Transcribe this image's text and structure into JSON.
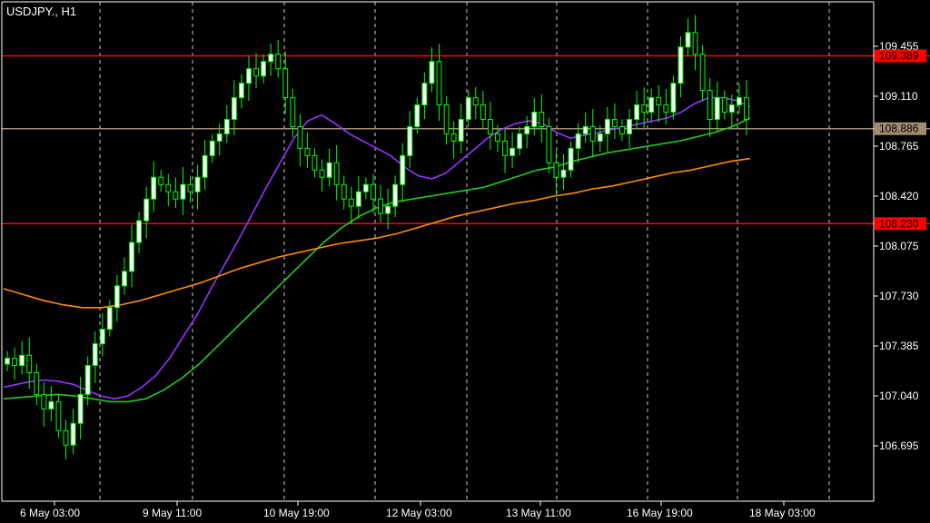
{
  "chart_data": {
    "type": "candlestick",
    "title": "USDJPY., H1",
    "x_ticks": [
      "6 May 03:00",
      "9 May 11:00",
      "10 May 19:00",
      "12 May 03:00",
      "13 May 11:00",
      "16 May 19:00",
      "18 May 03:00"
    ],
    "y_ticks": [
      109.455,
      109.11,
      108.765,
      108.42,
      108.075,
      107.73,
      107.385,
      107.04,
      106.695
    ],
    "ylim": [
      106.5,
      109.6
    ],
    "grid": true,
    "levels": [
      {
        "label": "109.389",
        "value": 109.389,
        "color": "#ff0000"
      },
      {
        "label": "108.886",
        "value": 108.886,
        "color": "#a08c6e"
      },
      {
        "label": "108.230",
        "value": 108.23,
        "color": "#ff0000"
      }
    ],
    "candles_close": [
      107.3,
      107.25,
      107.32,
      107.2,
      107.05,
      106.95,
      107.0,
      106.8,
      106.7,
      106.85,
      107.05,
      107.25,
      107.4,
      107.5,
      107.65,
      107.8,
      107.9,
      108.1,
      108.25,
      108.4,
      108.55,
      108.5,
      108.45,
      108.4,
      108.5,
      108.45,
      108.55,
      108.7,
      108.8,
      108.85,
      108.95,
      109.1,
      109.2,
      109.3,
      109.25,
      109.35,
      109.4,
      109.3,
      109.1,
      108.9,
      108.75,
      108.7,
      108.6,
      108.55,
      108.65,
      108.5,
      108.4,
      108.35,
      108.45,
      108.5,
      108.4,
      108.3,
      108.35,
      108.5,
      108.7,
      108.9,
      109.05,
      109.2,
      109.35,
      109.05,
      108.85,
      108.8,
      108.95,
      109.1,
      109.05,
      108.95,
      108.85,
      108.8,
      108.7,
      108.75,
      108.85,
      108.9,
      109.0,
      108.9,
      108.65,
      108.55,
      108.6,
      108.75,
      108.85,
      108.9,
      108.8,
      108.85,
      108.95,
      108.9,
      108.85,
      108.95,
      109.05,
      109.0,
      109.1,
      109.05,
      109.0,
      109.2,
      109.45,
      109.55,
      109.4,
      109.15,
      108.95,
      109.1,
      109.0,
      109.05,
      109.1,
      108.95
    ],
    "series": [
      {
        "name": "",
        "color": "#9933ff",
        "values": [
          107.1,
          107.12,
          107.14,
          107.15,
          107.14,
          107.12,
          107.08,
          107.04,
          107.02,
          107.04,
          107.1,
          107.18,
          107.3,
          107.45,
          107.6,
          107.78,
          107.95,
          108.12,
          108.3,
          108.48,
          108.65,
          108.82,
          108.94,
          108.98,
          108.92,
          108.85,
          108.8,
          108.75,
          108.7,
          108.62,
          108.56,
          108.54,
          108.58,
          108.66,
          108.74,
          108.82,
          108.88,
          108.92,
          108.94,
          108.92,
          108.86,
          108.82,
          108.84,
          108.86,
          108.88,
          108.9,
          108.92,
          108.94,
          108.96,
          109.0,
          109.06,
          109.1,
          109.1,
          109.08,
          109.04
        ]
      },
      {
        "name": "",
        "color": "#22cc22",
        "values": [
          107.02,
          107.03,
          107.04,
          107.05,
          107.04,
          107.02,
          107.0,
          107.0,
          107.02,
          107.08,
          107.16,
          107.26,
          107.38,
          107.5,
          107.62,
          107.74,
          107.86,
          107.98,
          108.1,
          108.2,
          108.28,
          108.34,
          108.38,
          108.4,
          108.42,
          108.44,
          108.46,
          108.48,
          108.52,
          108.56,
          108.6,
          108.62,
          108.66,
          108.69,
          108.72,
          108.74,
          108.76,
          108.78,
          108.8,
          108.83,
          108.86,
          108.9,
          108.96
        ]
      },
      {
        "name": "",
        "color": "#ff8c00",
        "values": [
          107.78,
          107.74,
          107.7,
          107.67,
          107.65,
          107.65,
          107.67,
          107.7,
          107.74,
          107.78,
          107.82,
          107.87,
          107.92,
          107.96,
          108.0,
          108.03,
          108.06,
          108.09,
          108.11,
          108.13,
          108.16,
          108.2,
          108.24,
          108.28,
          108.31,
          108.34,
          108.37,
          108.39,
          108.42,
          108.44,
          108.47,
          108.49,
          108.52,
          108.55,
          108.58,
          108.6,
          108.63,
          108.66,
          108.68
        ]
      }
    ],
    "candle_up_color": "#ffffff",
    "candle_down_color": "#000000",
    "wick_color": "#00ff00"
  }
}
